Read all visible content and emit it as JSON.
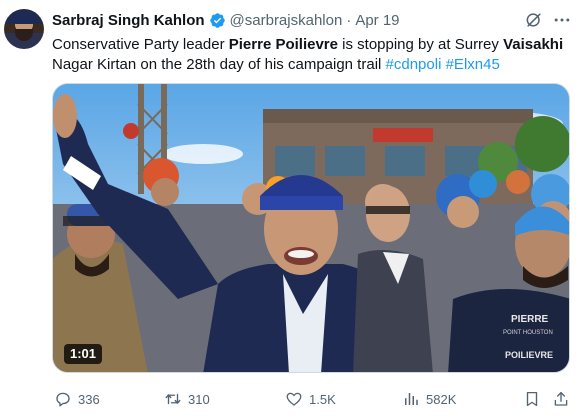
{
  "author": {
    "name": "Sarbraj Singh Kahlon",
    "handle": "@sarbrajskahlon",
    "separator": "·",
    "date": "Apr 19"
  },
  "tweet": {
    "text_1": "Conservative Party leader ",
    "bold_1": "Pierre Poilievre",
    "text_2": " is stopping by at Surrey ",
    "bold_2": "Vaisakhi",
    "text_3": "Nagar Kirtan on the 28th day of his campaign trail ",
    "hashtag_1": "#cdnpoli",
    "hashtag_2": "#Elxn45"
  },
  "media": {
    "duration": "1:01",
    "sign_text": "PIERRE",
    "sign_sub": "POINT HOUSTON",
    "sign_text_2": "POILIEVRE"
  },
  "actions": {
    "replies": "336",
    "reposts": "310",
    "likes": "1.5K",
    "views": "582K"
  },
  "colors": {
    "accent": "#1d9bf0",
    "muted": "#536471",
    "text": "#0f1419"
  },
  "icons": [
    "verified-badge-icon",
    "grok-icon",
    "more-icon",
    "reply-icon",
    "retweet-icon",
    "like-icon",
    "views-icon",
    "bookmark-icon",
    "share-icon"
  ]
}
